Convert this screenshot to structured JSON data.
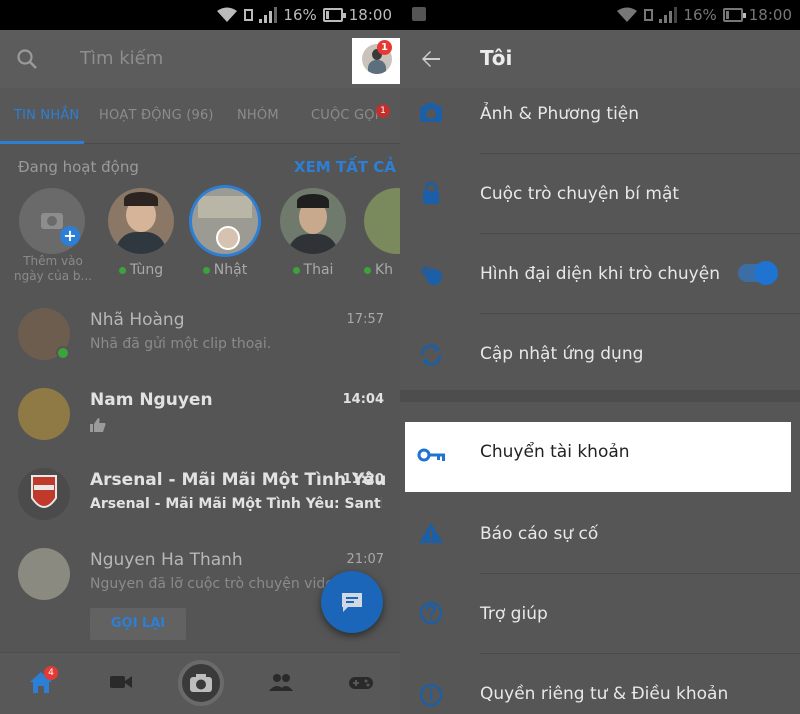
{
  "status_bar": {
    "battery": "16%",
    "time": "18:00"
  },
  "left": {
    "search": {
      "placeholder": "Tìm kiếm"
    },
    "profile_badge": "1",
    "tabs": [
      {
        "label": "TIN NHẮN",
        "active": true
      },
      {
        "label": "HOẠT ĐỘNG (96)",
        "active": false
      },
      {
        "label": "NHÓM",
        "active": false
      },
      {
        "label": "CUỘC GỌI",
        "active": false,
        "badge": "1"
      }
    ],
    "active_now": {
      "title": "Đang hoạt động",
      "see_all": "XEM TẤT CẢ",
      "add_label": "Thêm vào ngày của b...",
      "people": [
        {
          "name": "Tùng"
        },
        {
          "name": "Nhật"
        },
        {
          "name": "Thai"
        },
        {
          "name": "Kh"
        }
      ]
    },
    "conversations": [
      {
        "name": "Nhã Hoàng",
        "preview": "Nhã đã gửi một clip thoại.",
        "time": "17:57",
        "unread": false,
        "online": true
      },
      {
        "name": "Nam Nguyen",
        "preview": "",
        "time": "14:04",
        "unread": true,
        "like": true
      },
      {
        "name": "Arsenal - Mãi Mãi Một Tình Yêu",
        "preview": "Arsenal - Mãi Mãi Một Tình Yêu: Santi C...",
        "time": "11:20",
        "unread": true
      },
      {
        "name": "Nguyen Ha Thanh",
        "preview": "Nguyen đã lỡ cuộc trò chuyện video.",
        "time": "21:07",
        "unread": false
      }
    ],
    "call_back_label": "GỌI LẠI",
    "home_badge": "4"
  },
  "right": {
    "title": "Tôi",
    "items": [
      {
        "label": "Ảnh & Phương tiện",
        "icon": "camera-icon"
      },
      {
        "label": "Cuộc trò chuyện bí mật",
        "icon": "lock-icon"
      },
      {
        "label": "Hình đại diện khi trò chuyện",
        "icon": "chat-heads-icon",
        "toggle": true
      },
      {
        "label": "Cập nhật ứng dụng",
        "icon": "refresh-icon"
      },
      {
        "label": "Chuyển tài khoản",
        "icon": "key-icon",
        "highlighted": true
      },
      {
        "label": "Báo cáo sự cố",
        "icon": "warning-icon"
      },
      {
        "label": "Trợ giúp",
        "icon": "help-icon"
      },
      {
        "label": "Quyền riêng tư & Điều khoản",
        "icon": "info-icon"
      }
    ]
  },
  "colors": {
    "accent": "#2d7fd6",
    "badge": "#e53935",
    "online": "#3ca23c"
  }
}
